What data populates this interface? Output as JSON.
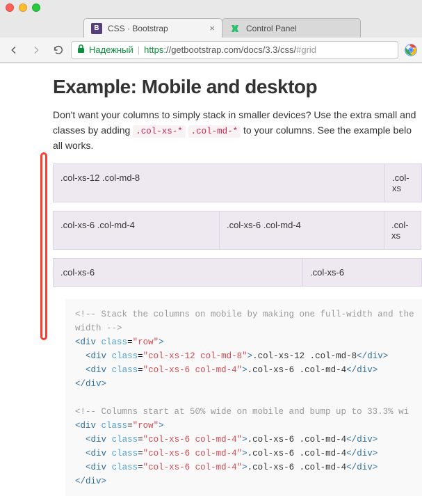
{
  "tabs": [
    {
      "title": "CSS · Bootstrap",
      "favicon": "B"
    },
    {
      "title": "Control Panel",
      "favicon": "cp"
    }
  ],
  "address": {
    "secure_label": "Надежный",
    "protocol": "https",
    "host": "://getbootstrap.com",
    "path": "/docs/3.3/css/",
    "fragment": "#grid"
  },
  "heading": "Example: Mobile and desktop",
  "intro": {
    "part1": "Don't want your columns to simply stack in smaller devices? Use the extra small and",
    "part2": "classes by adding ",
    "code1": ".col-xs-*",
    "code2": ".col-md-*",
    "part3": " to your columns. See the example belo",
    "part4": "all works."
  },
  "grid": {
    "rows": [
      [
        {
          "text": ".col-xs-12 .col-md-8",
          "flex": "0 0 478px"
        },
        {
          "text": ".col-xs",
          "flex": "0 0 54px"
        }
      ],
      [
        {
          "text": ".col-xs-6 .col-md-4",
          "flex": "0 0 240px"
        },
        {
          "text": ".col-xs-6 .col-md-4",
          "flex": "0 0 238px"
        },
        {
          "text": ".col-xs",
          "flex": "0 0 54px"
        }
      ],
      [
        {
          "text": ".col-xs-6",
          "flex": "0 0 360px"
        },
        {
          "text": ".col-xs-6",
          "flex": "0 0 172px"
        }
      ]
    ]
  },
  "code": {
    "comment1a": "<!-- Stack the columns on mobile by making one full-width and the",
    "comment1b": "width -->",
    "div": "div",
    "class_attr": "class",
    "row_val": "\"row\"",
    "c1_val": "\"col-xs-12 col-md-8\"",
    "c1_txt": ".col-xs-12 .col-md-8",
    "c2_val": "\"col-xs-6 col-md-4\"",
    "c2_txt": ".col-xs-6 .col-md-4",
    "comment2": "<!-- Columns start at 50% wide on mobile and bump up to 33.3% wi"
  }
}
